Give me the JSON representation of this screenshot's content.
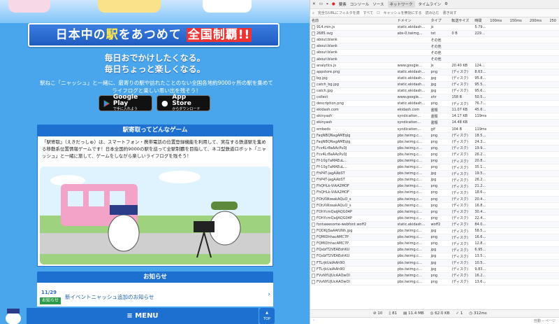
{
  "left": {
    "banner": {
      "part1": "日本中の",
      "part2": "駅",
      "part3": "をあつめて",
      "part4": "全国制覇!!"
    },
    "tagline1": "毎日おでかけしたくなる。",
    "tagline2": "毎日ちょっと楽しくなる。",
    "intro": "駅ねこ「ニャッシュ」と一緒に、最寄りの駅や訪れたことのない全国各地約9000ヶ所の駅を集めてライフログと楽しい思い出を残そう！",
    "google_play": {
      "small": "で手に入れよう",
      "big": "Google Play"
    },
    "app_store": {
      "small": "からダウンロード",
      "big": "App Store"
    },
    "section1": "駅寄取ってどんなゲーム",
    "section1_text": "「駅寄取」（えきだっしゅ）は、スマートフォン・携帯電話の位置登録機能を利用して、実在する鉄道駅を集める移動系位置情報ゲームです！日本全国約9000の駅を巡って全駅制覇を目指して、ネコ型鉄道ロボット「ニャッシュ」と一緒に旅して、ゲームをしながら楽しいライフログを残そう！",
    "news_head": "お知らせ",
    "news_date": "11/29",
    "news_tag": "お知らせ",
    "news_title": "新イベントニャッシュ追加のお知らせ",
    "menu": "≡ MENU",
    "top": "TOP"
  },
  "devtools": {
    "tabs": [
      "要素",
      "コンソール",
      "ソース",
      "ネットワーク",
      "タイムライン"
    ],
    "active_tab": "ネットワーク",
    "filter_placeholder": "完全なURLにフィルタを適",
    "filter_all": "すべて",
    "cache_toggle": "キャッシュを無効にする",
    "import": "読み込む",
    "export": "書き出す",
    "columns": [
      "名前",
      "ドメイン",
      "タイプ",
      "転送サイズ",
      "時間"
    ],
    "timeline_ticks": [
      "100ms",
      "150ms",
      "200ms",
      "250"
    ],
    "rows": [
      [
        "914.min.js",
        "static.ekidash…",
        "js",
        "",
        "5.79…"
      ],
      [
        "2685.svg",
        "abs-0.twimg…",
        "txt",
        "0 B",
        "229…"
      ],
      [
        "about:blank",
        "",
        "その他",
        "",
        ""
      ],
      [
        "about:blank",
        "",
        "その他",
        "",
        ""
      ],
      [
        "about:blank",
        "",
        "その他",
        "",
        ""
      ],
      [
        "about:blank",
        "",
        "その他",
        "",
        ""
      ],
      [
        "analytics.js",
        "www.google…",
        "js",
        "20.40 KB",
        "124…"
      ],
      [
        "appstore.png",
        "static.ekidash…",
        "png",
        "(ディスク)",
        "8.63…"
      ],
      [
        "bg.jpg",
        "static.ekidash…",
        "jpg",
        "(ディスク)",
        "95.8…"
      ],
      [
        "catch_bg.jpg",
        "static.ekidash…",
        "jpg",
        "(ディスク)",
        "95.5…"
      ],
      [
        "catch.jpg",
        "static.ekidash…",
        "jpg",
        "(ディスク)",
        "95.6…"
      ],
      [
        "collect",
        "www.google…",
        "xhr",
        "158 B",
        "50.5…"
      ],
      [
        "description.png",
        "static.ekidash…",
        "png",
        "(ディスク)",
        "76.7…"
      ],
      [
        "ekidash.com",
        "ekidash.com",
        "書類",
        "11.07 KB",
        "45.6…"
      ],
      [
        "ekinyash",
        "syndication…",
        "書類",
        "14.17 KB",
        "119ms"
      ],
      [
        "ekinyash",
        "syndication…",
        "書類",
        "14.48 KB",
        ""
      ],
      [
        "embeds",
        "syndication…",
        "gif",
        "104 B",
        "119ms"
      ],
      [
        "FaqNBQNagAMEqlg",
        "pbs.twimg.c…",
        "png",
        "(ディスク)",
        "18.5…"
      ],
      [
        "FaqNBQNagAMEqlg",
        "pbs.twimg.c…",
        "png",
        "(ディスク)",
        "24.3…"
      ],
      [
        "Fcv4Lr8aAAcPu0J",
        "pbs.twimg.c…",
        "png",
        "(ディスク)",
        "19.9…"
      ],
      [
        "Fcv4Lr8aAAcPu0J",
        "pbs.twimg.c…",
        "png",
        "(ディスク)",
        "26.2…"
      ],
      [
        "Ff-10g7aMAEuL…",
        "pbs.twimg.c…",
        "png",
        "(ディスク)",
        "20.8…"
      ],
      [
        "Ff-10g7aMAEuL…",
        "pbs.twimg.c…",
        "png",
        "(ディスク)",
        "35.1…"
      ],
      [
        "FhP4T-jagAAbST",
        "pbs.twimg.c…",
        "jpg",
        "(ディスク)",
        "19.5…"
      ],
      [
        "FhP4T-jagAAbST",
        "pbs.twimg.c…",
        "jpg",
        "(ディスク)",
        "26.2…"
      ],
      [
        "FhQHLk-ViAA2MOF",
        "pbs.twimg.c…",
        "png",
        "(ディスク)",
        "21.2…"
      ],
      [
        "FhQHLk-ViAA2MOF",
        "pbs.twimg.c…",
        "png",
        "(ディスク)",
        "18.6…"
      ],
      [
        "FOhXWzeakAQuO_s",
        "pbs.twimg.c…",
        "png",
        "(ディスク)",
        "20.4…"
      ],
      [
        "FOhXWzeakAQuO_s",
        "pbs.twimg.c…",
        "png",
        "(ディスク)",
        "16.8…"
      ],
      [
        "FOhYcmQaiJAQG04P",
        "pbs.twimg.c…",
        "png",
        "(ディスク)",
        "30.4…"
      ],
      [
        "FOhYcmQaiJAQG04P",
        "pbs.twimg.c…",
        "png",
        "(ディスク)",
        "22.4…"
      ],
      [
        "fontawesome-webfont.woff2",
        "static.ekidash…",
        "woff2",
        "(ディスク)",
        "84.0…"
      ],
      [
        "FQDKjjSaAAfUNh.jpg",
        "pbs.twimg.c…",
        "jpg",
        "(ディスク)",
        "58.5…"
      ],
      [
        "FQMIDhhacAMC7P",
        "pbs.twimg.c…",
        "png",
        "(ディスク)",
        "16.6…"
      ],
      [
        "FQMIDhhacAMC7P",
        "pbs.twimg.c…",
        "png",
        "(ディスク)",
        "12.8…"
      ],
      [
        "FQxbfT2VEAEohKU",
        "pbs.twimg.c…",
        "jpg",
        "(ディスク)",
        "6.95…"
      ],
      [
        "FQxbfT2VEAEohKU",
        "pbs.twimg.c…",
        "jpg",
        "(ディスク)",
        "13.5…"
      ],
      [
        "FTLrjkUaIAAh9O",
        "pbs.twimg.c…",
        "jpg",
        "(ディスク)",
        "10.5…"
      ],
      [
        "FTLrjkUaIAAh9O",
        "pbs.twimg.c…",
        "jpg",
        "(ディスク)",
        "9.83…"
      ],
      [
        "FVvNYUJUcAAOwOl",
        "pbs.twimg.c…",
        "png",
        "(ディスク)",
        "16.2…"
      ],
      [
        "FVvNYUJUcAAOwOl",
        "pbs.twimg.c…",
        "png",
        "(ディスク)",
        "13.6…"
      ]
    ],
    "status": {
      "requests": "10",
      "files": "81",
      "size": "11.4 MB",
      "transferred": "62.0 KB",
      "errors": "1",
      "time": "312ms"
    },
    "console_context": "自動 ─ ページ"
  }
}
